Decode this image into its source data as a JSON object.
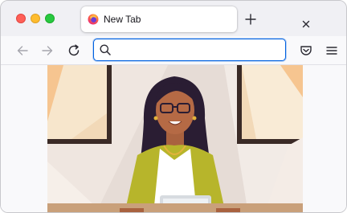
{
  "window": {
    "controls": [
      "close",
      "minimize",
      "zoom"
    ]
  },
  "tab": {
    "title": "New Tab",
    "favicon": "firefox-icon"
  },
  "toolbar": {
    "back_icon": "arrow-left-icon",
    "forward_icon": "arrow-right-icon",
    "reload_icon": "reload-icon",
    "pocket_icon": "pocket-icon",
    "menu_icon": "hamburger-menu-icon"
  },
  "urlbar": {
    "value": "",
    "placeholder": "",
    "icon": "search-icon"
  },
  "content": {
    "image": "illustration-woman-at-laptop"
  },
  "colors": {
    "accent": "#0061e0",
    "chrome": "#f0f0f4",
    "toolbar": "#f9f9fb",
    "close": "#ff5f57",
    "minimize": "#febc2e",
    "zoom": "#28c840"
  }
}
